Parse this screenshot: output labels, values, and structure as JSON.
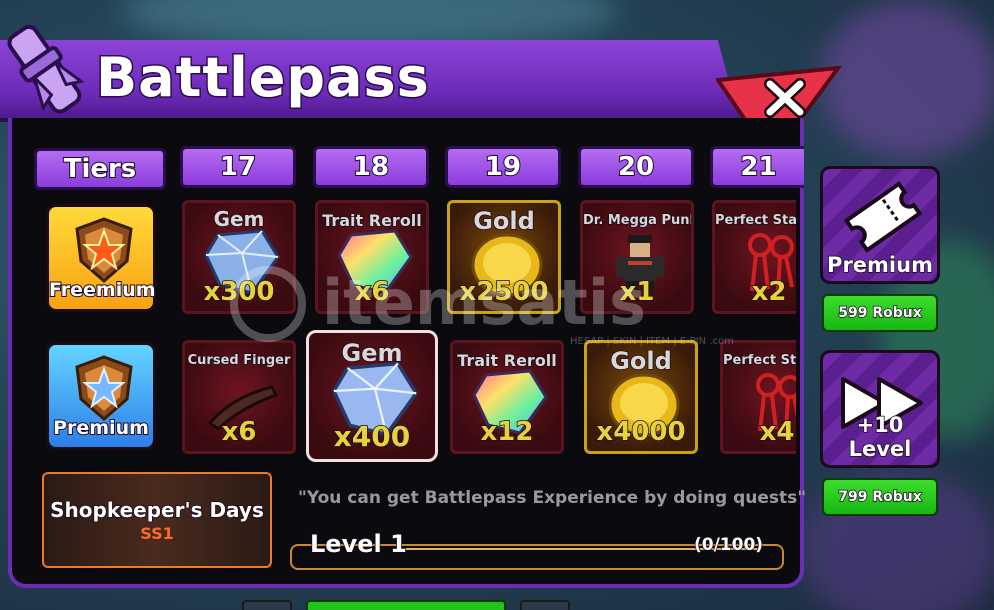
{
  "title": "Battlepass",
  "close_icon": "close-x-icon",
  "tiers_header": "Tiers",
  "tier_numbers": [
    "17",
    "18",
    "19",
    "20",
    "21"
  ],
  "tier_rows": {
    "freemium_label": "Freemium",
    "premium_label": "Premium"
  },
  "free_rewards": [
    {
      "name": "Gem",
      "qty": "x300",
      "icon": "gem-icon"
    },
    {
      "name": "Trait Reroll",
      "qty": "x6",
      "icon": "trait-reroll-icon"
    },
    {
      "name": "Gold",
      "qty": "x2500",
      "icon": "gold-coin-icon"
    },
    {
      "name": "Dr. Megga Punk",
      "qty": "x1",
      "icon": "character-icon"
    },
    {
      "name": "Perfect Stats K",
      "qty": "x2",
      "icon": "perfect-stats-key-icon"
    }
  ],
  "premium_rewards": [
    {
      "name": "Cursed Finger",
      "qty": "x6",
      "icon": "cursed-finger-icon"
    },
    {
      "name": "Gem",
      "qty": "x400",
      "icon": "gem-icon"
    },
    {
      "name": "Trait Reroll",
      "qty": "x12",
      "icon": "trait-reroll-icon"
    },
    {
      "name": "Gold",
      "qty": "x4000",
      "icon": "gold-coin-icon"
    },
    {
      "name": "Perfect Stats K",
      "qty": "x4",
      "icon": "perfect-stats-key-icon"
    }
  ],
  "event": {
    "title": "Shopkeeper's Days",
    "season": "SS1"
  },
  "hint": "\"You can get Battlepass Experience by doing quests\"",
  "level": {
    "label": "Level 1",
    "progress_text": "(0/100)",
    "progress_fraction": 0
  },
  "side": {
    "premium_label": "Premium",
    "premium_price": "599 Robux",
    "level_label": "+10 Level",
    "level_price": "799 Robux"
  },
  "watermark": {
    "text": "itemsatis",
    "subtext": "HESAP | SKIN | ITEM | E-PIN .com"
  },
  "colors": {
    "accent_purple": "#8b3ddc",
    "close_red": "#e8324a",
    "price_green": "#22c41c",
    "qty_yellow": "#e6d23a"
  }
}
